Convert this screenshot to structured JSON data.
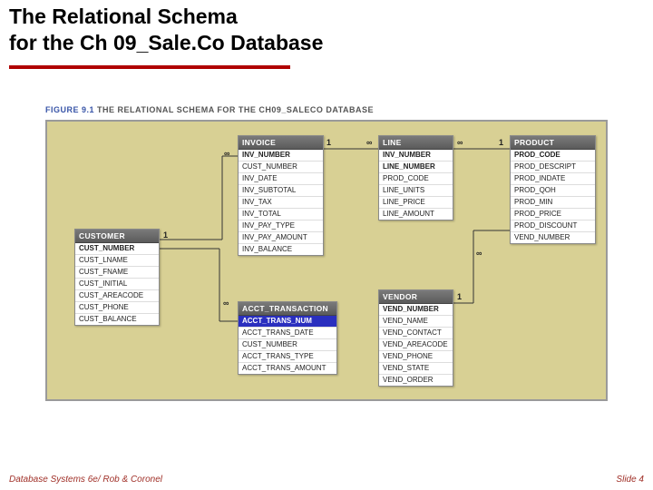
{
  "slide": {
    "title_line1": "The Relational Schema",
    "title_line2": "for the Ch 09_Sale.Co Database"
  },
  "figure": {
    "label": "FIGURE 9.1",
    "caption": "THE RELATIONAL SCHEMA FOR THE CH09_SALECO DATABASE"
  },
  "entities": {
    "customer": {
      "name": "CUSTOMER",
      "fields": [
        "CUST_NUMBER",
        "CUST_LNAME",
        "CUST_FNAME",
        "CUST_INITIAL",
        "CUST_AREACODE",
        "CUST_PHONE",
        "CUST_BALANCE"
      ]
    },
    "invoice": {
      "name": "INVOICE",
      "fields": [
        "INV_NUMBER",
        "CUST_NUMBER",
        "INV_DATE",
        "INV_SUBTOTAL",
        "INV_TAX",
        "INV_TOTAL",
        "INV_PAY_TYPE",
        "INV_PAY_AMOUNT",
        "INV_BALANCE"
      ]
    },
    "acct_transaction": {
      "name": "ACCT_TRANSACTION",
      "fields": [
        "ACCT_TRANS_NUM",
        "ACCT_TRANS_DATE",
        "CUST_NUMBER",
        "ACCT_TRANS_TYPE",
        "ACCT_TRANS_AMOUNT"
      ]
    },
    "line": {
      "name": "LINE",
      "fields": [
        "INV_NUMBER",
        "LINE_NUMBER",
        "PROD_CODE",
        "LINE_UNITS",
        "LINE_PRICE",
        "LINE_AMOUNT"
      ]
    },
    "vendor": {
      "name": "VENDOR",
      "fields": [
        "VEND_NUMBER",
        "VEND_NAME",
        "VEND_CONTACT",
        "VEND_AREACODE",
        "VEND_PHONE",
        "VEND_STATE",
        "VEND_ORDER"
      ]
    },
    "product": {
      "name": "PRODUCT",
      "fields": [
        "PROD_CODE",
        "PROD_DESCRIPT",
        "PROD_INDATE",
        "PROD_QOH",
        "PROD_MIN",
        "PROD_PRICE",
        "PROD_DISCOUNT",
        "VEND_NUMBER"
      ]
    }
  },
  "cardinality": {
    "one": "1",
    "many": "∞"
  },
  "footer": {
    "left": "Database Systems 6e/ Rob & Coronel",
    "right": "Slide 4"
  }
}
